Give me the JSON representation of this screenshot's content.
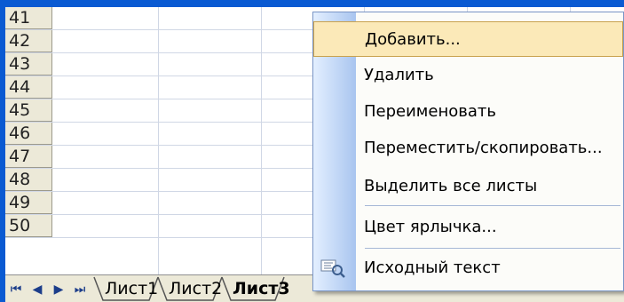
{
  "grid": {
    "rows": [
      "41",
      "42",
      "43",
      "44",
      "45",
      "46",
      "47",
      "48",
      "49",
      "50"
    ]
  },
  "sheet_tabs": {
    "nav_first": "⏮",
    "nav_prev": "◀",
    "nav_next": "▶",
    "nav_last": "⏭",
    "tabs": [
      {
        "label": "Лист1",
        "active": false
      },
      {
        "label": "Лист2",
        "active": false
      },
      {
        "label": "Лист3",
        "active": true
      }
    ]
  },
  "context_menu": {
    "items": [
      {
        "label": "Добавить...",
        "highlighted": true
      },
      {
        "label": "Удалить"
      },
      {
        "label": "Переименовать"
      },
      {
        "label": "Переместить/скопировать..."
      },
      {
        "label": "Выделить все листы"
      },
      {
        "label": "Цвет ярлычка..."
      },
      {
        "label": "Исходный текст",
        "icon": "view-code-icon"
      }
    ]
  },
  "colors": {
    "background": "#0a5ad2",
    "grid_line": "#d0d7e5",
    "header_bg": "#ece9d8",
    "highlight": "#fbe9b8",
    "menu_gutter": "#a9c5ef"
  }
}
